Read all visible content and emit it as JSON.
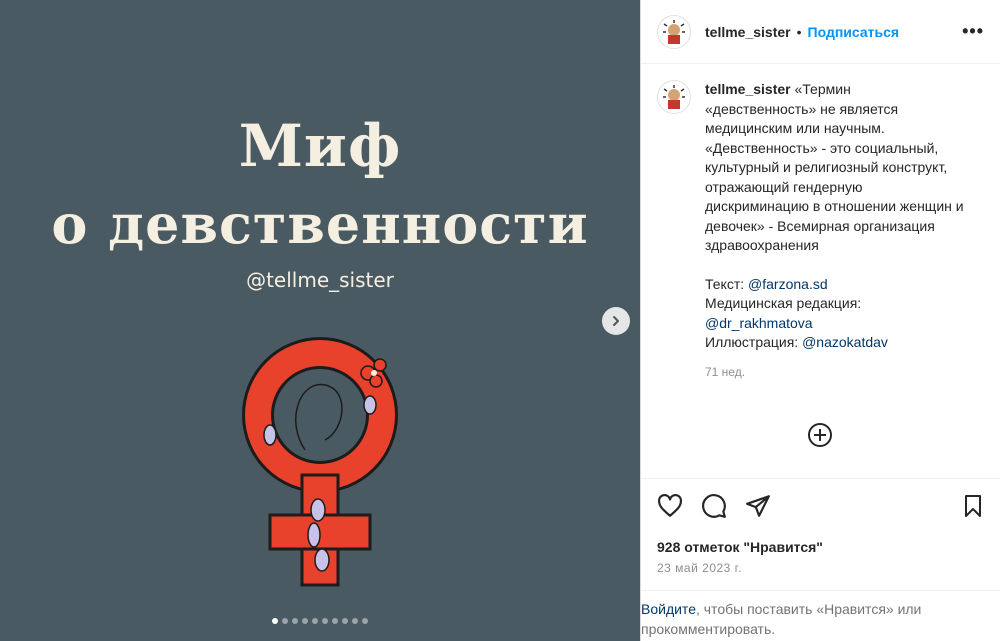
{
  "post_image": {
    "title_line1": "Миф",
    "title_line2": "о девственности",
    "handle": "@tellme_sister",
    "carousel_count": 10,
    "carousel_active": 0,
    "bg_color": "#4a5a63",
    "symbol_color": "#e8412c"
  },
  "header": {
    "username": "tellme_sister",
    "separator": "•",
    "follow_label": "Подписаться",
    "more_label": "•••"
  },
  "caption": {
    "username": "tellme_sister",
    "text": "«Термин «девственность» не является медицинским или научным. «Девственность» - это социальный, культурный и религиозный конструкт, отражающий гендерную дискриминацию в отношении женщин и девочек» - Всемирная организация здравоохранения",
    "credit_text_label": "Текст:",
    "credit_text_link": "@farzona.sd",
    "credit_edit_label": "Медицинская редакция:",
    "credit_edit_link": "@dr_rakhmatova",
    "credit_illus_label": "Иллюстрация:",
    "credit_illus_link": "@nazokatdav",
    "time": "71 нед."
  },
  "actions": {
    "likes": "928 отметок \"Нравится\"",
    "date": "23 май 2023 г."
  },
  "login_note": {
    "link": "Войдите",
    "text": ", чтобы поставить «Нравится» или прокомментировать."
  }
}
